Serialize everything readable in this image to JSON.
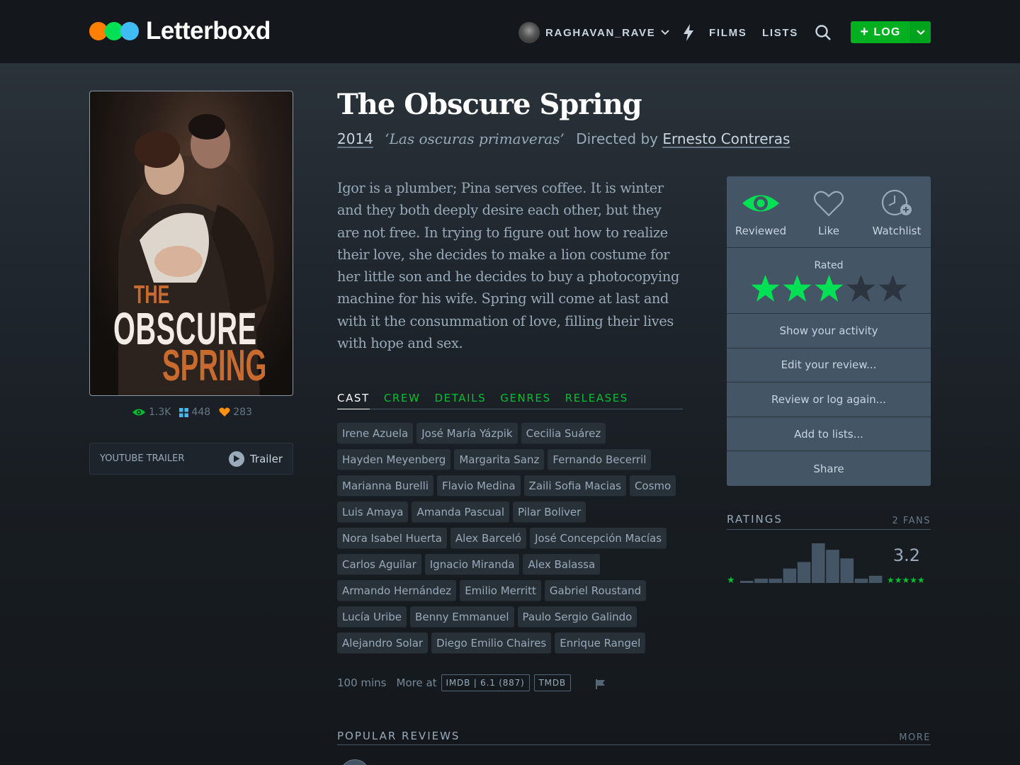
{
  "header": {
    "logo": "Letterboxd",
    "logo_colors": [
      "#ff8000",
      "#00e054",
      "#40bcf4"
    ],
    "username": "RAGHAVAN_RAVE",
    "nav": {
      "films": "FILMS",
      "lists": "LISTS"
    },
    "log_button": "LOG",
    "accent": "#00b020"
  },
  "film": {
    "title": "The Obscure Spring",
    "year": "2014",
    "original_title": "‘Las oscuras primaveras’",
    "directed_by_label": "Directed by",
    "director": "Ernesto Contreras",
    "synopsis": "Igor is a plumber; Pina serves coffee. It is winter and they both deeply desire each other, but they are not free. In trying to figure out how to realize their love, she decides to make a lion costume for her little son and he decides to buy a photocopying machine for his wife. Spring will come at last and with it the consummation of love, filling their lives with hope and sex.",
    "poster": {
      "line1": "THE",
      "line2": "OBSCURE",
      "line3": "SPRING"
    },
    "stats": {
      "watched": "1.3K",
      "lists": "448",
      "likes": "283"
    },
    "trailer": {
      "label": "YOUTUBE TRAILER",
      "button": "Trailer"
    }
  },
  "tabs": [
    "CAST",
    "CREW",
    "DETAILS",
    "GENRES",
    "RELEASES"
  ],
  "cast": [
    "Irene Azuela",
    "José María Yázpik",
    "Cecilia Suárez",
    "Hayden Meyenberg",
    "Margarita Sanz",
    "Fernando Becerril",
    "Marianna Burelli",
    "Flavio Medina",
    "Zaili Sofia Macias",
    "Cosmo",
    "Luis Amaya",
    "Amanda Pascual",
    "Pilar Boliver",
    "Nora Isabel Huerta",
    "Alex Barceló",
    "José Concepción Macías",
    "Carlos Aguilar",
    "Ignacio Miranda",
    "Alex Balassa",
    "Armando Hernández",
    "Emilio Merritt",
    "Gabriel Roustand",
    "Lucía Uribe",
    "Benny Emmanuel",
    "Paulo Sergio Galindo",
    "Alejandro Solar",
    "Diego Emilio Chaires",
    "Enrique Rangel"
  ],
  "footer": {
    "runtime": "100 mins",
    "more_at": "More at",
    "imdb": "IMDB | 6.1 (887)",
    "tmdb": "TMDB"
  },
  "popular_reviews": {
    "heading": "POPULAR REVIEWS",
    "more": "MORE"
  },
  "actions": {
    "reviewed": "Reviewed",
    "like": "Like",
    "watchlist": "Watchlist",
    "rated_label": "Rated",
    "user_rating": 3,
    "max_rating": 5,
    "menu": [
      "Show your activity",
      "Edit your review...",
      "Review or log again...",
      "Add to lists...",
      "Share"
    ]
  },
  "ratings": {
    "heading": "RATINGS",
    "fans": "2 FANS",
    "average": "3.2",
    "histogram": [
      2,
      6,
      6,
      20,
      29,
      55,
      46,
      34,
      6,
      10
    ]
  }
}
